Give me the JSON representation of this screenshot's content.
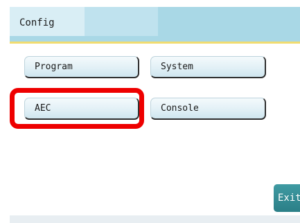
{
  "header": {
    "title": "Config"
  },
  "menu": {
    "program_label": "Program",
    "system_label": "System",
    "aec_label": "AEC",
    "console_label": "Console"
  },
  "footer": {
    "exit_label": "Exit"
  },
  "colors": {
    "header_bg": "#a9d8e6",
    "accent_line": "#f1dc70",
    "highlight": "#ee0000",
    "exit_button": "#2b7f87"
  }
}
